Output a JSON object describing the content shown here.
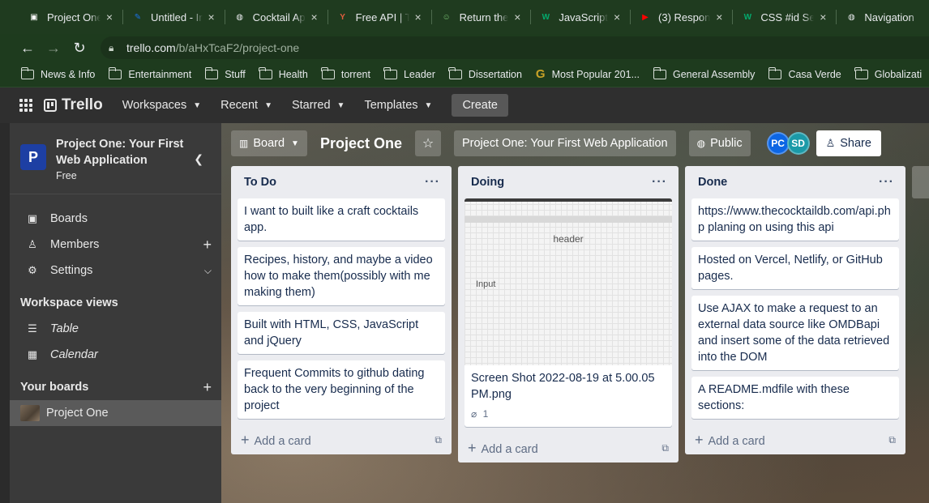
{
  "browser": {
    "tabs": [
      {
        "title": "Project One",
        "icon": "trello-icon",
        "color": "#ffffff"
      },
      {
        "title": "Untitled - Ir",
        "icon": "doc-icon",
        "color": "#1a73e8"
      },
      {
        "title": "Cocktail Ap",
        "icon": "globe-icon",
        "color": "#e8eaed"
      },
      {
        "title": "Free API | T",
        "icon": "cocktail-icon",
        "color": "#e35d3f"
      },
      {
        "title": "Return the",
        "icon": "avatar-icon",
        "color": "#7cc576"
      },
      {
        "title": "JavaScript",
        "icon": "w3-icon",
        "color": "#04aa6d"
      },
      {
        "title": "(3) Respon",
        "icon": "youtube-icon",
        "color": "#ff0000"
      },
      {
        "title": "CSS #id Se",
        "icon": "w3-icon",
        "color": "#04aa6d"
      },
      {
        "title": "Navigation",
        "icon": "globe-icon",
        "color": "#e8eaed"
      }
    ],
    "url_host": "trello.com",
    "url_path": "/b/aHxTcaF2/project-one",
    "bookmarks": [
      "News & Info",
      "Entertainment",
      "Stuff",
      "Health",
      "torrent",
      "Leader",
      "Dissertation",
      "Most Popular 201...",
      "General Assembly",
      "Casa Verde",
      "Globalizati"
    ]
  },
  "header": {
    "logo": "Trello",
    "menus": [
      "Workspaces",
      "Recent",
      "Starred",
      "Templates"
    ],
    "create": "Create"
  },
  "sidebar": {
    "workspace_initial": "P",
    "workspace_name": "Project One: Your First Web Application",
    "workspace_plan": "Free",
    "nav": [
      {
        "label": "Boards",
        "icon": "board-icon"
      },
      {
        "label": "Members",
        "icon": "person-icon"
      },
      {
        "label": "Settings",
        "icon": "gear-icon"
      }
    ],
    "views_heading": "Workspace views",
    "views": [
      {
        "label": "Table",
        "icon": "table-icon"
      },
      {
        "label": "Calendar",
        "icon": "calendar-icon"
      }
    ],
    "boards_heading": "Your boards",
    "boards": [
      "Project One"
    ]
  },
  "board": {
    "view": "Board",
    "title": "Project One",
    "workspace": "Project One: Your First Web Application",
    "visibility": "Public",
    "members": [
      {
        "initials": "PC",
        "color": "#0c66e4"
      },
      {
        "initials": "SD",
        "color": "#1b9aa8"
      }
    ],
    "share": "Share",
    "add_card": "Add a card",
    "lists": [
      {
        "title": "To Do",
        "cards": [
          "I want to built like a craft cocktails app.",
          "Recipes, history, and maybe a video how to make them(possibly with me making them)",
          "Built with HTML, CSS, JavaScript and jQuery",
          "Frequent Commits to github dating back to the very beginning of the project"
        ]
      },
      {
        "title": "Doing",
        "cover": {
          "heading": "header",
          "input_label": "Input"
        },
        "cards": [
          "Screen Shot 2022-08-19 at 5.00.05 PM.png"
        ],
        "attachments": "1"
      },
      {
        "title": "Done",
        "cards": [
          "https://www.thecocktaildb.com/api.php planing on using this api",
          "Hosted on Vercel, Netlify, or GitHub pages.",
          "Use AJAX to make a request to an external data source like OMDBapi and insert some of the data retrieved into the DOM",
          "A README.mdfile with these sections:"
        ]
      }
    ]
  }
}
